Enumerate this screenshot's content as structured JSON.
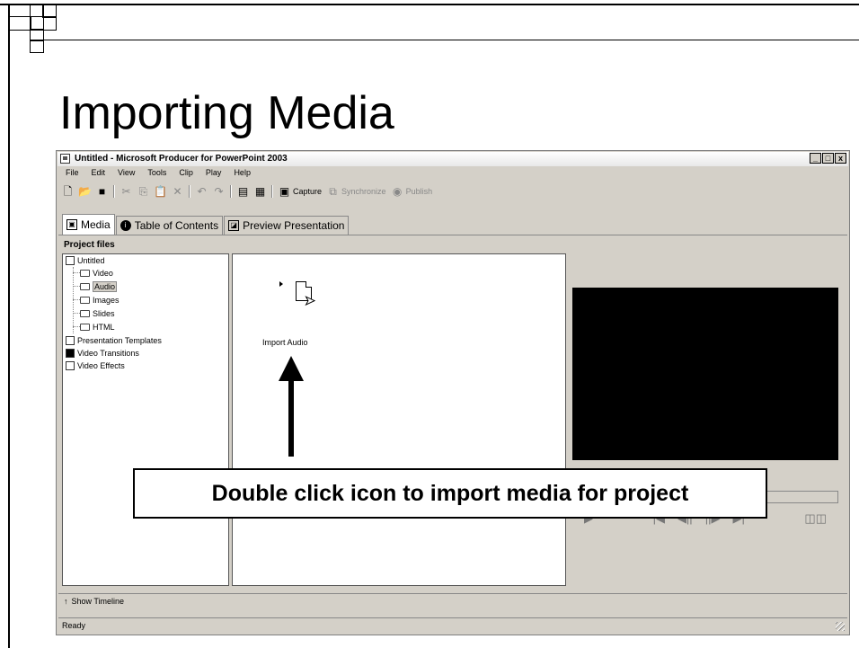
{
  "slide": {
    "title": "Importing Media"
  },
  "window": {
    "title": "Untitled - Microsoft Producer for PowerPoint 2003",
    "controls": {
      "minimize": "_",
      "maximize": "□",
      "close": "x"
    }
  },
  "menu": [
    "File",
    "Edit",
    "View",
    "Tools",
    "Clip",
    "Play",
    "Help"
  ],
  "toolbar": {
    "capture_label": "Capture",
    "synchronize_label": "Synchronize",
    "publish_label": "Publish"
  },
  "tabs": [
    "Media",
    "Table of Contents",
    "Preview Presentation"
  ],
  "project_files": {
    "heading": "Project files",
    "root": "Untitled",
    "folders": [
      "Video",
      "Audio",
      "Images",
      "Slides",
      "HTML"
    ],
    "selected": "Audio",
    "extras": [
      "Presentation Templates",
      "Video Transitions",
      "Video Effects"
    ]
  },
  "media_panel": {
    "import_label": "Import Audio"
  },
  "timeline": {
    "label": "Show Timeline"
  },
  "status": {
    "text": "Ready"
  },
  "annotation": {
    "callout": "Double click icon to import media for project"
  },
  "colors": {
    "preview_bg": "#000000",
    "window_bg": "#d4d0c8"
  }
}
